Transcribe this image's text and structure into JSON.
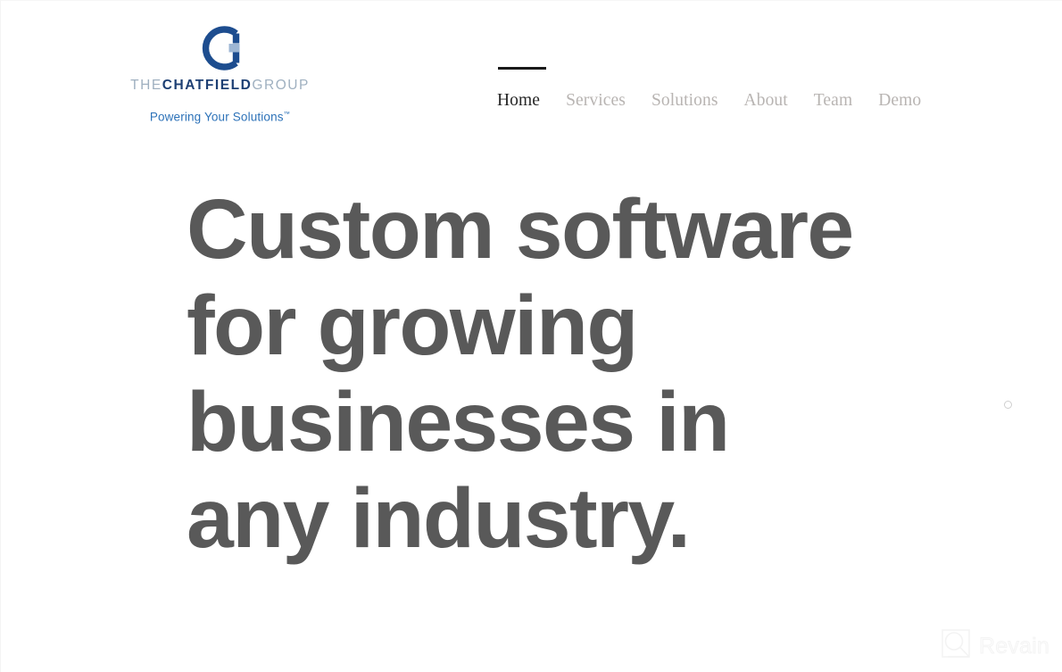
{
  "site": {
    "background_color": "#ffffff"
  },
  "header": {
    "brand": {
      "logo_icon": "chatfield-c-g-mark",
      "logo_color": "#1d4d8f",
      "wordmark": {
        "prefix": "THE",
        "emphasis": "CHATFIELD",
        "suffix": "GROUP",
        "prefix_color": "#9fb0c0",
        "emphasis_color": "#1d3f73",
        "suffix_color": "#9fb0c0"
      },
      "tagline": "Powering Your Solutions",
      "tagline_trademark": "™",
      "tagline_color": "#2d72b8"
    },
    "nav": {
      "active_index": 0,
      "active_indicator_color": "#1a1a1a",
      "active_color": "#262626",
      "inactive_color": "#b8b4b2",
      "items": [
        {
          "label": "Home"
        },
        {
          "label": "Services"
        },
        {
          "label": "Solutions"
        },
        {
          "label": "About"
        },
        {
          "label": "Team"
        },
        {
          "label": "Demo"
        }
      ]
    }
  },
  "hero": {
    "heading_color": "#595959",
    "heading_lines": [
      "Custom software",
      "for growing",
      "businesses in",
      "any industry."
    ],
    "scroll_dot_icon": "circle-outline-icon"
  },
  "watermark": {
    "label": "Revain",
    "icon": "revain-magnifier-icon",
    "color": "#f2f2f2"
  }
}
